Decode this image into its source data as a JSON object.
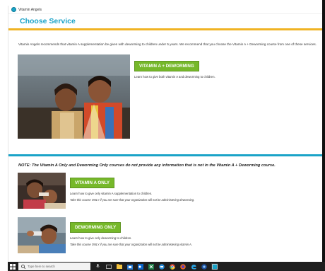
{
  "window": {
    "title": "Vitamin Angels"
  },
  "header": {
    "title": "Choose Service"
  },
  "intro": "Vitamin Angels recommends that vitamin A supplementation be given with deworming to children under 5 years. We recommend that you choose the Vitamin A + Deworming course from one of these services.",
  "courses": [
    {
      "button": "VITAMIN A + DEWORMING",
      "description": "Learn how to give both vitamin A and deworming to children."
    },
    {
      "button": "VITAMIN A ONLY",
      "description": "Learn how to give only vitamin A supplementation to children.",
      "note": "Take this course ONLY if you are sure that your organization will not be administering deworming."
    },
    {
      "button": "DEWORMING ONLY",
      "description": "Learn how to give only deworming to children.",
      "note": "Take this course ONLY if you are sure that your organization will not be administering vitamin A."
    }
  ],
  "note": "NOTE: The Vitamin A Only and Deworming Only courses do not provide any information that is not in the Vitamin A + Deworming course.",
  "taskbar": {
    "search_placeholder": "Type here to search"
  },
  "colors": {
    "accent_blue": "#1aa3c8",
    "accent_orange": "#f0b323",
    "button_green": "#76b82a"
  }
}
